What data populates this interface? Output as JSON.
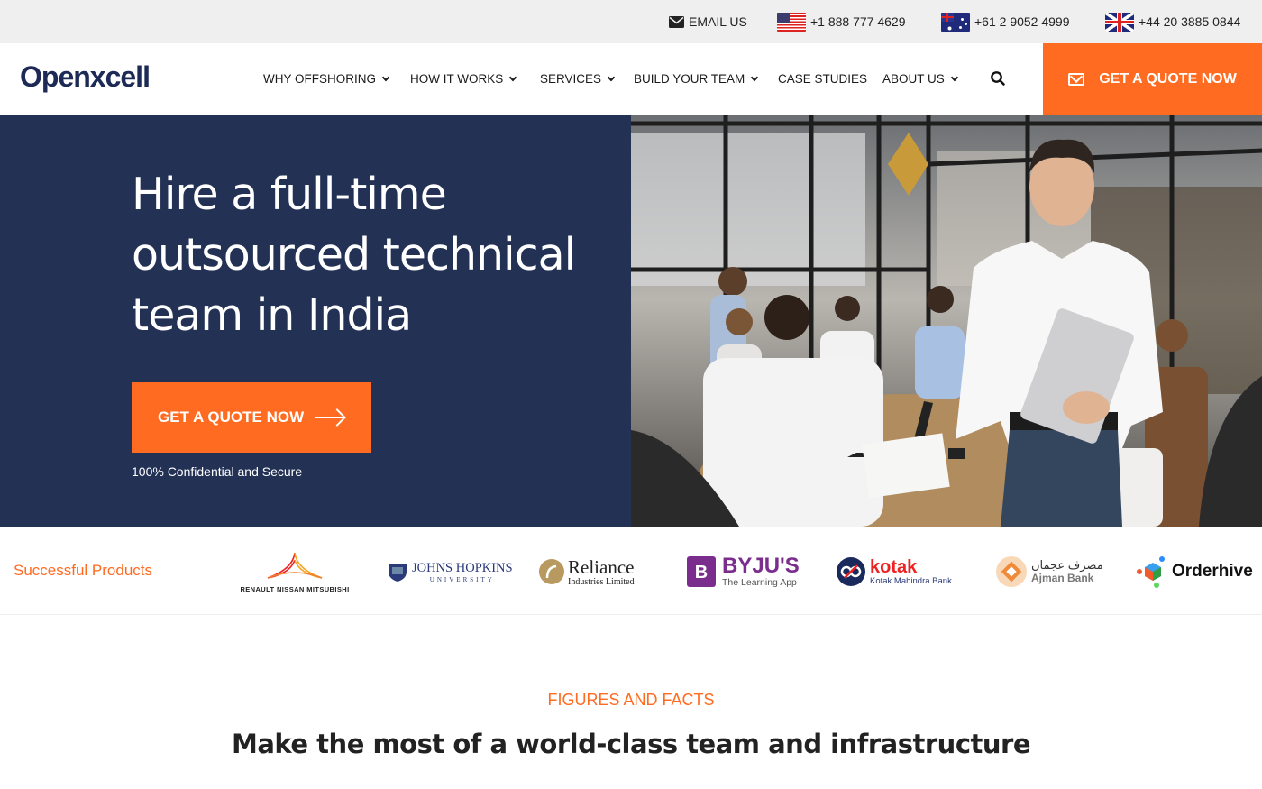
{
  "topbar": {
    "email_label": "EMAIL US",
    "phones": [
      {
        "country": "US",
        "number": "+1 888 777 4629"
      },
      {
        "country": "AU",
        "number": "+61 2 9052 4999"
      },
      {
        "country": "UK",
        "number": "+44 20 3885 0844"
      }
    ]
  },
  "header": {
    "logo_text": "Openxcell",
    "nav": [
      {
        "label": "WHY OFFSHORING",
        "has_dropdown": true
      },
      {
        "label": "HOW IT WORKS",
        "has_dropdown": true
      },
      {
        "label": "SERVICES",
        "has_dropdown": true
      },
      {
        "label": "BUILD YOUR TEAM",
        "has_dropdown": true
      },
      {
        "label": "CASE STUDIES",
        "has_dropdown": false
      },
      {
        "label": "ABOUT US",
        "has_dropdown": true
      }
    ],
    "search_icon": "search-icon",
    "quote_button": "GET A QUOTE NOW"
  },
  "hero": {
    "title": "Hire a full-time outsourced technical team in India",
    "cta_label": "GET A QUOTE NOW",
    "note": "100% Confidential and Secure",
    "image_alt": "Smiling man in white shirt holding laptop in front of team meeting in office"
  },
  "clients": {
    "label": "Successful Products",
    "logos": [
      {
        "name": "RENAULT NISSAN MITSUBISHI"
      },
      {
        "name": "JOHNS HOPKINS",
        "sub": "UNIVERSITY"
      },
      {
        "name": "Reliance",
        "sub": "Industries Limited"
      },
      {
        "name": "BYJU'S",
        "sub": "The Learning App"
      },
      {
        "name": "kotak",
        "sub": "Kotak Mahindra Bank"
      },
      {
        "name": "مصرف عجمان",
        "sub": "Ajman Bank"
      },
      {
        "name": "Orderhive"
      }
    ]
  },
  "figures": {
    "label": "FIGURES AND FACTS",
    "title": "Make the most of a world-class team and infrastructure"
  },
  "colors": {
    "accent": "#ff6b21",
    "navy": "#233155",
    "logo": "#1c2a55"
  }
}
